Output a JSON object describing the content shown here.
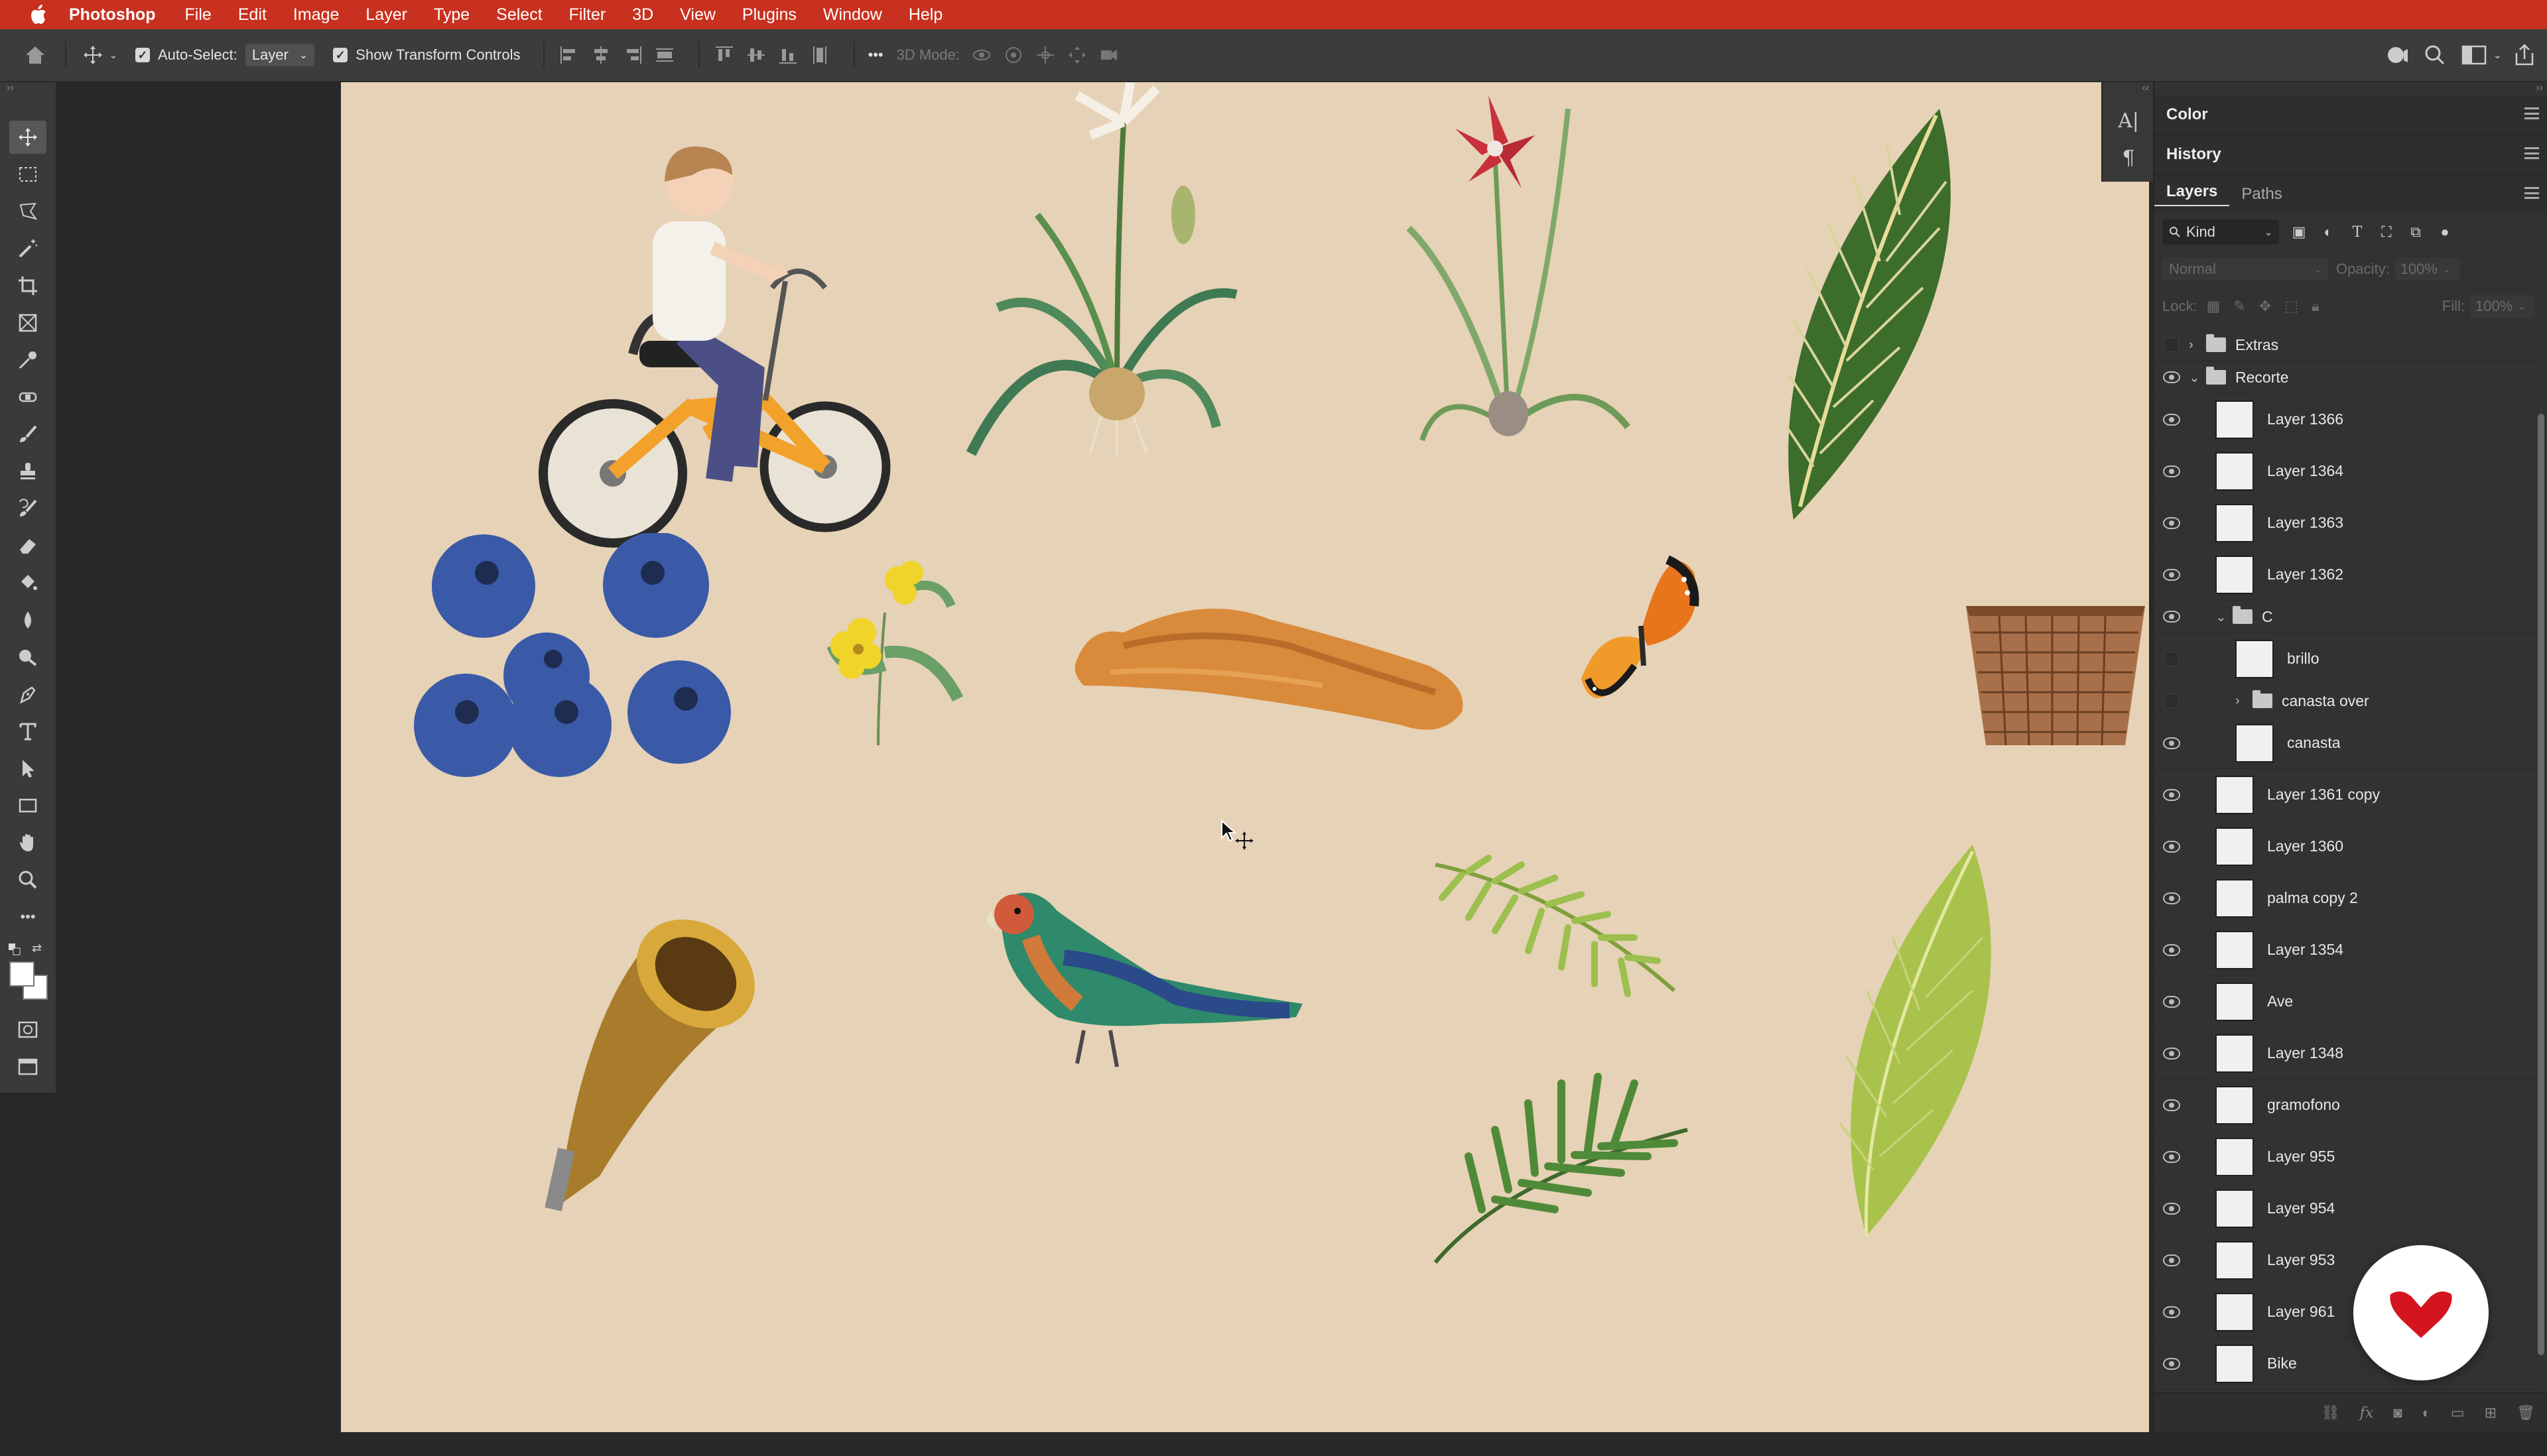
{
  "menubar": {
    "app_name": "Photoshop",
    "items": [
      "File",
      "Edit",
      "Image",
      "Layer",
      "Type",
      "Select",
      "Filter",
      "3D",
      "View",
      "Plugins",
      "Window",
      "Help"
    ]
  },
  "options": {
    "auto_select_label": "Auto-Select:",
    "auto_select_checked": true,
    "auto_select_value": "Layer",
    "show_transform_label": "Show Transform Controls",
    "show_transform_checked": true,
    "more_label": "•••",
    "three_d_mode_label": "3D Mode:"
  },
  "tools": [
    "move-tool-icon",
    "marquee-tool-icon",
    "lasso-tool-icon",
    "magic-wand-tool-icon",
    "crop-tool-icon",
    "frame-tool-icon",
    "eyedropper-tool-icon",
    "healing-brush-tool-icon",
    "brush-tool-icon",
    "clone-stamp-tool-icon",
    "history-brush-tool-icon",
    "eraser-tool-icon",
    "paint-bucket-tool-icon",
    "blur-tool-icon",
    "dodge-tool-icon",
    "pen-tool-icon",
    "type-tool-icon",
    "path-selection-tool-icon",
    "rectangle-tool-icon",
    "hand-tool-icon",
    "zoom-tool-icon",
    "more-tools-icon"
  ],
  "panels": {
    "color_title": "Color",
    "history_title": "History",
    "layers_tab": "Layers",
    "paths_tab": "Paths",
    "filter_kind": "Kind",
    "blend_mode": "Normal",
    "opacity_label": "Opacity:",
    "opacity_value": "100%",
    "lock_label": "Lock:",
    "fill_label": "Fill:",
    "fill_value": "100%"
  },
  "layers": [
    {
      "name": "Extras",
      "type": "group",
      "visible": false,
      "expanded": false,
      "indent": 0
    },
    {
      "name": "Recorte",
      "type": "group",
      "visible": true,
      "expanded": true,
      "indent": 0
    },
    {
      "name": "Layer 1366",
      "type": "layer",
      "visible": true,
      "indent": 1
    },
    {
      "name": "Layer 1364",
      "type": "layer",
      "visible": true,
      "indent": 1
    },
    {
      "name": "Layer 1363",
      "type": "layer",
      "visible": true,
      "indent": 1
    },
    {
      "name": "Layer 1362",
      "type": "layer",
      "visible": true,
      "indent": 1
    },
    {
      "name": "C",
      "type": "group",
      "visible": true,
      "expanded": true,
      "indent": 1
    },
    {
      "name": "brillo",
      "type": "layer",
      "visible": false,
      "indent": 2
    },
    {
      "name": "canasta over",
      "type": "group",
      "visible": false,
      "expanded": false,
      "indent": 2
    },
    {
      "name": "canasta",
      "type": "layer",
      "visible": true,
      "indent": 2
    },
    {
      "name": "Layer 1361 copy",
      "type": "layer",
      "visible": true,
      "indent": 1
    },
    {
      "name": "Layer 1360",
      "type": "layer",
      "visible": true,
      "indent": 1
    },
    {
      "name": "palma copy 2",
      "type": "layer",
      "visible": true,
      "indent": 1
    },
    {
      "name": "Layer 1354",
      "type": "layer",
      "visible": true,
      "indent": 1
    },
    {
      "name": "Ave",
      "type": "layer",
      "visible": true,
      "indent": 1
    },
    {
      "name": "Layer 1348",
      "type": "layer",
      "visible": true,
      "indent": 1
    },
    {
      "name": "gramofono",
      "type": "layer",
      "visible": true,
      "indent": 1
    },
    {
      "name": "Layer 955",
      "type": "layer",
      "visible": true,
      "indent": 1
    },
    {
      "name": "Layer 954",
      "type": "layer",
      "visible": true,
      "indent": 1
    },
    {
      "name": "Layer 953",
      "type": "layer",
      "visible": true,
      "indent": 1
    },
    {
      "name": "Layer 961",
      "type": "layer",
      "visible": true,
      "indent": 1
    },
    {
      "name": "Bike",
      "type": "layer",
      "visible": true,
      "indent": 1
    }
  ],
  "colors": {
    "menubar": "#c8311f",
    "canvas_bg": "#e6d2b6",
    "panel_bg": "#323232",
    "badge_mark": "#d4151f"
  }
}
